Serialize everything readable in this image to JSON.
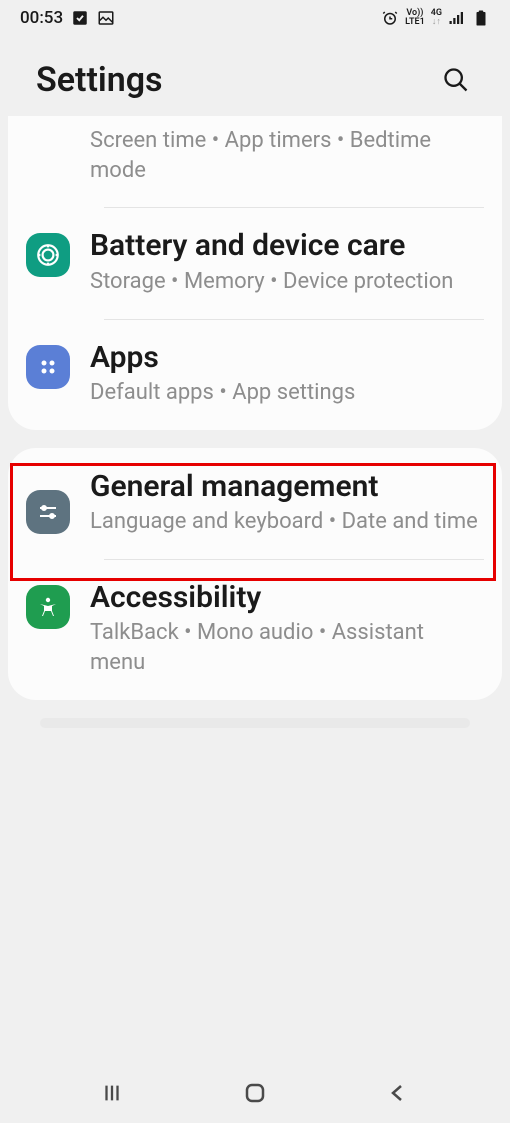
{
  "status": {
    "time": "00:53",
    "network_volte": "Vo))",
    "network_lte": "LTE1",
    "network_4g": "4G"
  },
  "header": {
    "title": "Settings"
  },
  "card1": {
    "row0": {
      "sub": "Screen time  •  App timers  •  Bedtime mode"
    },
    "row1": {
      "title": "Battery and device care",
      "sub": "Storage  •  Memory  •  Device protection"
    },
    "row2": {
      "title": "Apps",
      "sub": "Default apps  •  App settings"
    }
  },
  "card2": {
    "row0": {
      "title": "General management",
      "sub": "Language and keyboard  •  Date and time"
    },
    "row1": {
      "title": "Accessibility",
      "sub": "TalkBack  •  Mono audio  •  Assistant menu"
    }
  },
  "highlight": {
    "target": "apps-row"
  }
}
